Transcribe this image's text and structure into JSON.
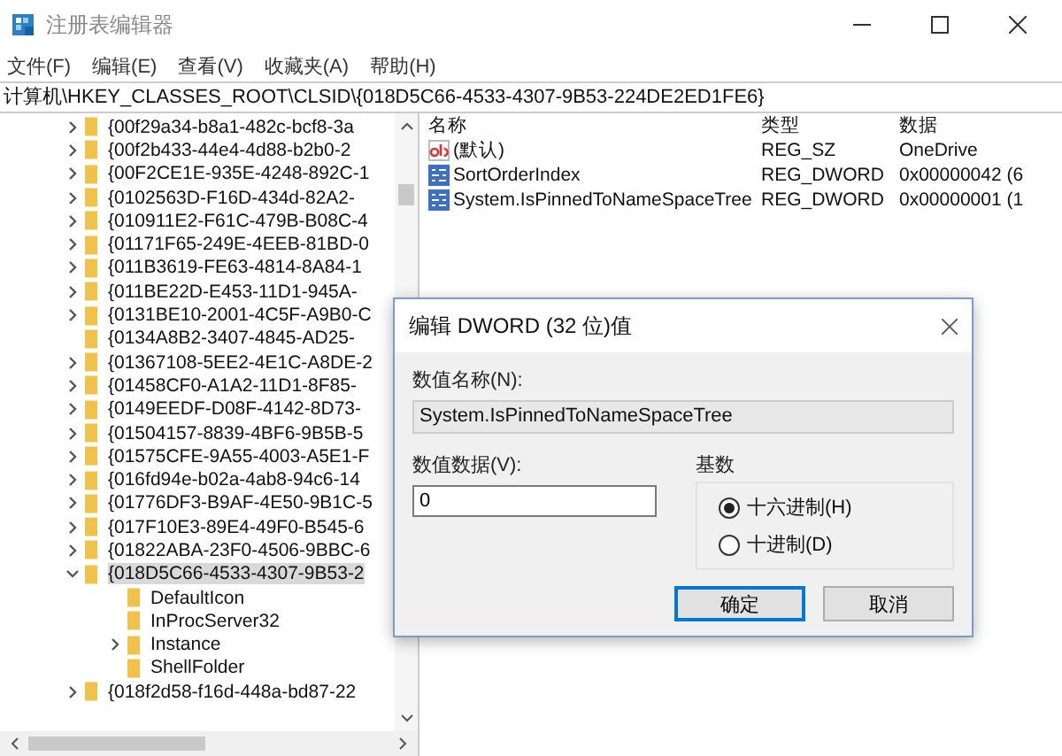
{
  "window": {
    "title": "注册表编辑器"
  },
  "menu": [
    "文件(F)",
    "编辑(E)",
    "查看(V)",
    "收藏夹(A)",
    "帮助(H)"
  ],
  "address": "计算机\\HKEY_CLASSES_ROOT\\CLSID\\{018D5C66-4533-4307-9B53-224DE2ED1FE6}",
  "tree": [
    {
      "label": "{00f29a34-b8a1-482c-bcf8-3a",
      "has_children": true,
      "expanded": false,
      "selected": false
    },
    {
      "label": "{00f2b433-44e4-4d88-b2b0-2",
      "has_children": true,
      "expanded": false,
      "selected": false
    },
    {
      "label": "{00F2CE1E-935E-4248-892C-1",
      "has_children": true,
      "expanded": false,
      "selected": false
    },
    {
      "label": "{0102563D-F16D-434d-82A2-",
      "has_children": true,
      "expanded": false,
      "selected": false
    },
    {
      "label": "{010911E2-F61C-479B-B08C-4",
      "has_children": true,
      "expanded": false,
      "selected": false
    },
    {
      "label": "{01171F65-249E-4EEB-81BD-0",
      "has_children": true,
      "expanded": false,
      "selected": false
    },
    {
      "label": "{011B3619-FE63-4814-8A84-1",
      "has_children": true,
      "expanded": false,
      "selected": false
    },
    {
      "label": "{011BE22D-E453-11D1-945A-",
      "has_children": true,
      "expanded": false,
      "selected": false
    },
    {
      "label": "{0131BE10-2001-4C5F-A9B0-C",
      "has_children": true,
      "expanded": false,
      "selected": false
    },
    {
      "label": "{0134A8B2-3407-4845-AD25-",
      "has_children": false,
      "selected": false
    },
    {
      "label": "{01367108-5EE2-4E1C-A8DE-2",
      "has_children": true,
      "expanded": false,
      "selected": false
    },
    {
      "label": "{01458CF0-A1A2-11D1-8F85-",
      "has_children": true,
      "expanded": false,
      "selected": false
    },
    {
      "label": "{0149EEDF-D08F-4142-8D73-",
      "has_children": true,
      "expanded": false,
      "selected": false
    },
    {
      "label": "{01504157-8839-4BF6-9B5B-5",
      "has_children": true,
      "expanded": false,
      "selected": false
    },
    {
      "label": "{01575CFE-9A55-4003-A5E1-F",
      "has_children": true,
      "expanded": false,
      "selected": false
    },
    {
      "label": "{016fd94e-b02a-4ab8-94c6-14",
      "has_children": true,
      "expanded": false,
      "selected": false
    },
    {
      "label": "{01776DF3-B9AF-4E50-9B1C-5",
      "has_children": true,
      "expanded": false,
      "selected": false
    },
    {
      "label": "{017F10E3-89E4-49F0-B545-6",
      "has_children": true,
      "expanded": false,
      "selected": false
    },
    {
      "label": "{01822ABA-23F0-4506-9BBC-6",
      "has_children": true,
      "expanded": false,
      "selected": false
    },
    {
      "label": "{018D5C66-4533-4307-9B53-2",
      "has_children": true,
      "expanded": true,
      "selected": true,
      "children": [
        {
          "label": "DefaultIcon",
          "has_children": false,
          "selected": false
        },
        {
          "label": "InProcServer32",
          "has_children": false,
          "selected": false
        },
        {
          "label": "Instance",
          "has_children": true,
          "selected": false
        },
        {
          "label": "ShellFolder",
          "has_children": false,
          "selected": false
        }
      ]
    },
    {
      "label": "{018f2d58-f16d-448a-bd87-22",
      "has_children": true,
      "expanded": false,
      "selected": false
    }
  ],
  "values": {
    "columns": [
      "名称",
      "类型",
      "数据"
    ],
    "rows": [
      {
        "kind": "string",
        "name": "(默认)",
        "type": "REG_SZ",
        "data": "OneDrive"
      },
      {
        "kind": "binary",
        "name": "SortOrderIndex",
        "type": "REG_DWORD",
        "data": "0x00000042 (6"
      },
      {
        "kind": "binary",
        "name": "System.IsPinnedToNameSpaceTree",
        "type": "REG_DWORD",
        "data": "0x00000001 (1"
      }
    ]
  },
  "dialog": {
    "title": "编辑 DWORD (32 位)值",
    "name_label": "数值名称(N):",
    "name_value": "System.IsPinnedToNameSpaceTree",
    "data_label": "数值数据(V):",
    "data_value": "0",
    "base_label": "基数",
    "radios": [
      {
        "label": "十六进制(H)",
        "selected": true
      },
      {
        "label": "十进制(D)",
        "selected": false
      }
    ],
    "buttons": [
      {
        "label": "确定",
        "default": true
      },
      {
        "label": "取消",
        "default": false
      }
    ]
  }
}
